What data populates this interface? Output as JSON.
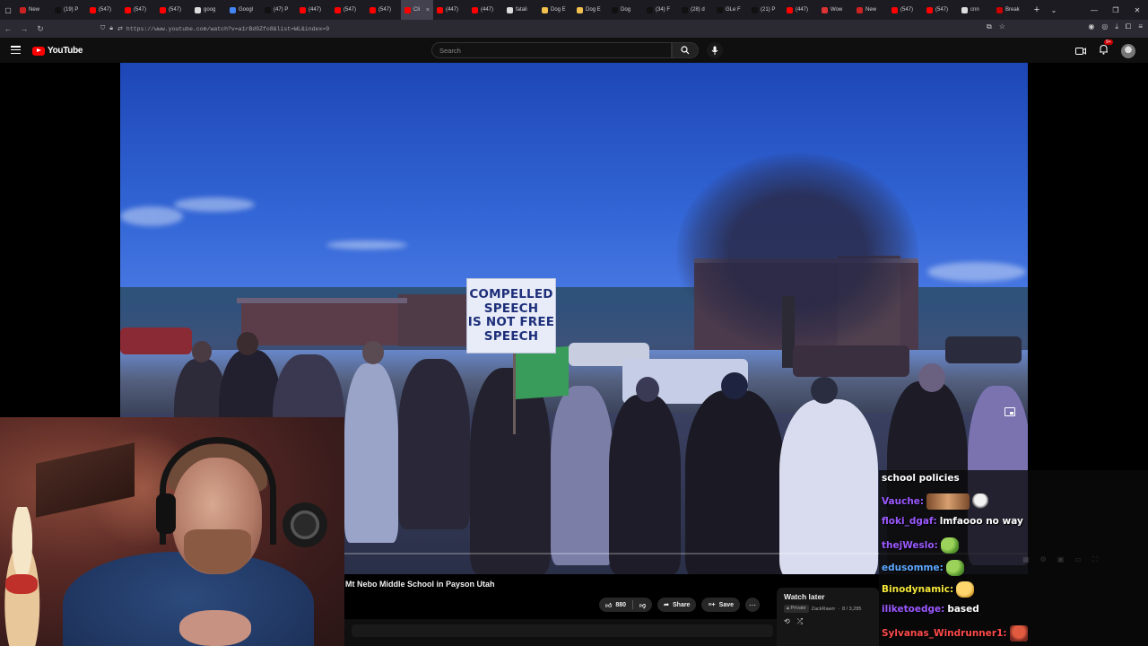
{
  "browser": {
    "tabs": [
      {
        "label": "New",
        "color": "#cc2222"
      },
      {
        "label": "(19) P",
        "color": "#111111"
      },
      {
        "label": "(547)",
        "color": "#ff0000"
      },
      {
        "label": "(547)",
        "color": "#ff0000"
      },
      {
        "label": "(547)",
        "color": "#ff0000"
      },
      {
        "label": "goog",
        "color": "#dddddd"
      },
      {
        "label": "Googl",
        "color": "#4285f4"
      },
      {
        "label": "(47) P",
        "color": "#111111"
      },
      {
        "label": "(447)",
        "color": "#ff0000"
      },
      {
        "label": "(547)",
        "color": "#ff0000"
      },
      {
        "label": "(547)",
        "color": "#ff0000"
      },
      {
        "label": "Cli",
        "color": "#ff0000",
        "active": true
      },
      {
        "label": "(447)",
        "color": "#ff0000"
      },
      {
        "label": "(447)",
        "color": "#ff0000"
      },
      {
        "label": "fatali",
        "color": "#dddddd"
      },
      {
        "label": "Dog E",
        "color": "#f2c14e"
      },
      {
        "label": "Dog E",
        "color": "#f2c14e"
      },
      {
        "label": "Dog",
        "color": "#111111"
      },
      {
        "label": "(34) F",
        "color": "#111111"
      },
      {
        "label": "(28) d",
        "color": "#111111"
      },
      {
        "label": "GLe F",
        "color": "#111111"
      },
      {
        "label": "(21) P",
        "color": "#111111"
      },
      {
        "label": "(447)",
        "color": "#ff0000"
      },
      {
        "label": "Wow",
        "color": "#d33"
      },
      {
        "label": "New",
        "color": "#cc2222"
      },
      {
        "label": "(547)",
        "color": "#ff0000"
      },
      {
        "label": "(547)",
        "color": "#ff0000"
      },
      {
        "label": "cnn",
        "color": "#dddddd"
      },
      {
        "label": "Break",
        "color": "#cc0000"
      }
    ],
    "new_tab": "+",
    "url": "https://www.youtube.com/watch?v=a1rBd9Zfo8&list=WL&index=9"
  },
  "youtube": {
    "logo_text": "YouTube",
    "search_placeholder": "Search",
    "notification_badge": "9+"
  },
  "video": {
    "sign_lines": [
      "COMPELLED",
      "SPEECH",
      "IS NOT FREE",
      "SPEECH"
    ],
    "title": "Mt Nebo Middle School in Payson Utah",
    "like_count": "880",
    "share_label": "Share",
    "save_label": "Save"
  },
  "watch_later": {
    "title": "Watch later",
    "privacy": "Private",
    "owner": "ZackRawrr",
    "position": "8 / 3,285"
  },
  "chat": {
    "header": "school policies",
    "messages": [
      {
        "user": "Vauche:",
        "user_color": "#9b59ff",
        "text": "",
        "emotes": [
          "face",
          "skull"
        ]
      },
      {
        "user": "floki_dgaf:",
        "user_color": "#9b59ff",
        "text": "lmfaooo no way",
        "emotes": []
      },
      {
        "user": "thejWeslo:",
        "user_color": "#9b59ff",
        "text": "",
        "emotes": [
          "pepe"
        ]
      },
      {
        "user": "edusomme:",
        "user_color": "#5da8ff",
        "text": "",
        "emotes": [
          "pepe"
        ]
      },
      {
        "user": "Binodynamic:",
        "user_color": "#f5e83a",
        "text": "",
        "emotes": [
          "laugh"
        ]
      },
      {
        "user": "iliketoedge:",
        "user_color": "#9b59ff",
        "text": "based",
        "emotes": []
      },
      {
        "user": "Sylvanas_Windrunner1:",
        "user_color": "#ff4a4a",
        "text": "",
        "emotes": [
          "man"
        ]
      }
    ]
  }
}
